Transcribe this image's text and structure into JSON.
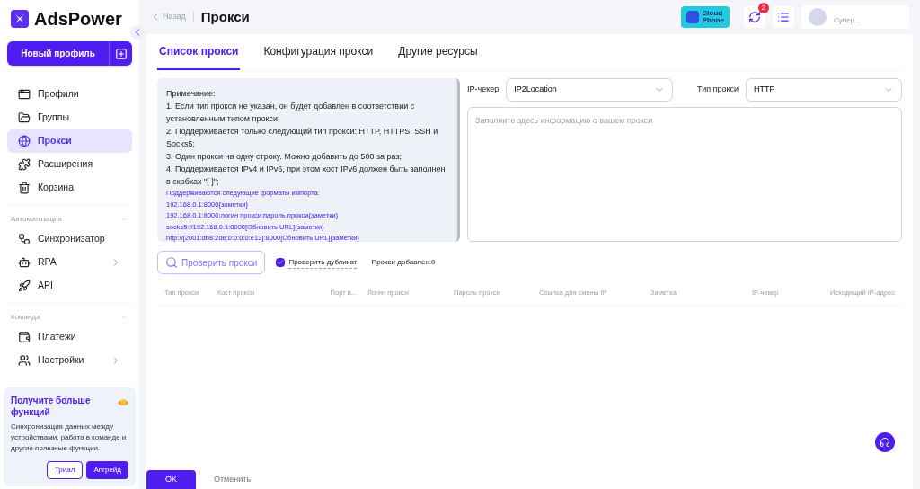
{
  "brand": {
    "name": "AdsPower"
  },
  "sidebar": {
    "new_profile": "Новый профиль",
    "items": [
      {
        "label": "Профили",
        "selected": false,
        "submenu": false
      },
      {
        "label": "Группы",
        "selected": false,
        "submenu": false
      },
      {
        "label": "Прокси",
        "selected": true,
        "submenu": false
      },
      {
        "label": "Расширения",
        "selected": false,
        "submenu": false
      },
      {
        "label": "Корзина",
        "selected": false,
        "submenu": false
      }
    ],
    "sections": [
      {
        "title": "Автоматизация",
        "items": [
          {
            "label": "Синхронизатор",
            "selected": false,
            "submenu": false
          },
          {
            "label": "RPA",
            "selected": false,
            "submenu": true
          },
          {
            "label": "API",
            "selected": false,
            "submenu": false
          }
        ]
      },
      {
        "title": "Команда",
        "items": [
          {
            "label": "Платежи",
            "selected": false,
            "submenu": false
          },
          {
            "label": "Настройки",
            "selected": false,
            "submenu": true
          }
        ]
      }
    ],
    "promo": {
      "title": "Получите больше функций",
      "text": "Синхронизация данных между устройствами, работа в команде и другие полезные функции.",
      "buttons": [
        "Триал",
        "Апгрейд"
      ]
    }
  },
  "header": {
    "back": "Назад",
    "title": "Прокси",
    "cloud_phone": [
      "Cloud",
      "Phone"
    ],
    "badge": "2",
    "user": "Супер..."
  },
  "tabs": [
    {
      "label": "Список прокси",
      "selected": true
    },
    {
      "label": "Конфигурация прокси",
      "selected": false
    },
    {
      "label": "Другие ресурсы",
      "selected": false
    }
  ],
  "note": {
    "lines": [
      "Примечание:",
      "1. Если тип прокси не указан, он будет добавлен в соответствии с установленным типом прокси;",
      "2. Поддерживается только следующий тип прокси: HTTP, HTTPS, SSH и Socks5;",
      "3. Один прокси на одну строку. Можно добавить до 500 за раз;",
      "4. Поддерживается IPv4 и IPv6, при этом хост IPv6 должен быть заполнен в скобках \"[ ]\";"
    ],
    "formats": [
      "Поддерживаются следующие форматы импорта:",
      "192.168.0.1:8000{заметки}",
      "192.168.0.1:8000:логин прокси:пароль прокси{заметки}",
      "socks5://192.168.0.1:8000[Обновить URL]{заметки}",
      "http://[2001:db8:2de:0:0:0:0:e13]:8000[Обновить URL]{заметки}"
    ]
  },
  "ip_checker": {
    "label": "IP-чекер",
    "value": "IP2Location"
  },
  "proxy_type": {
    "label": "Тип прокси",
    "value": "HTTP"
  },
  "proxy_input": {
    "placeholder": "Заполните здесь информацию о вашем прокси"
  },
  "check_button": "Проверить прокси",
  "check_duplicate": {
    "label": "Проверить дубликат",
    "checked": true
  },
  "added": "Прокси добавлен:0",
  "table": {
    "columns": [
      "Тип прокси",
      "Хост прокси",
      "Порт п...",
      "Логин прокси",
      "Пароль прокси",
      "Ссылка для смены IP",
      "Заметка",
      "IP-чекер",
      "Исходящий IP-адрес"
    ]
  },
  "footer": {
    "ok": "OK",
    "cancel": "Отменить"
  }
}
